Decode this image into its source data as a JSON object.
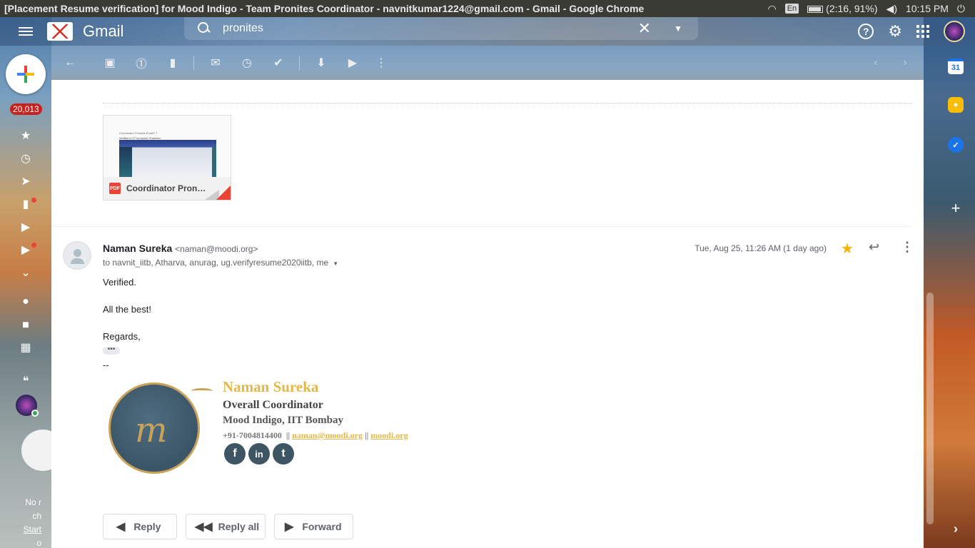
{
  "os_bar": {
    "window_title": "[Placement Resume verification] for Mood Indigo - Team Pronites Coordinator - navnitkumar1224@gmail.com - Gmail - Google Chrome",
    "lang": "En",
    "battery": "(2:16, 91%)",
    "time": "10:15 PM"
  },
  "header": {
    "app_name": "Gmail",
    "search_query": "pronites"
  },
  "rail": {
    "unread_count": "20,013",
    "footer_lines": [
      "No r",
      "ch",
      "Start",
      "o"
    ]
  },
  "attachment": {
    "badge": "PDF",
    "filename": "Coordinator Pronit...",
    "preview_title": "Coordinator Pronites Email? 7",
    "preview_subtitle": "Verified in 17 by Ayush Chauhan"
  },
  "message": {
    "sender_name": "Naman Sureka",
    "sender_email": "<naman@moodi.org>",
    "recipients": "to navnit_iitb, Atharva, anurag, ug.verifyresume2020iitb, me",
    "date": "Tue, Aug 25, 11:26 AM (1 day ago)",
    "body": {
      "line1": "Verified.",
      "line2": "All the best!",
      "line3": "Regards,",
      "ellipsis": "•••",
      "separator": "--"
    }
  },
  "signature": {
    "name": "Naman Sureka",
    "title": "Overall Coordinator",
    "org": "Mood Indigo, IIT Bombay",
    "phone": "+91-7004814400",
    "email": "naman@moodi.org",
    "website": "moodi.org",
    "sep": "||",
    "social": [
      "f",
      "in",
      "t"
    ]
  },
  "actions": {
    "reply": "Reply",
    "reply_all": "Reply all",
    "forward": "Forward"
  },
  "side_panel": {
    "calendar_day": "31"
  },
  "colors": {
    "gmail_red": "#d93025",
    "star": "#f4b400",
    "signature_gold": "#e2b84c",
    "badge_red": "#c5221f"
  }
}
